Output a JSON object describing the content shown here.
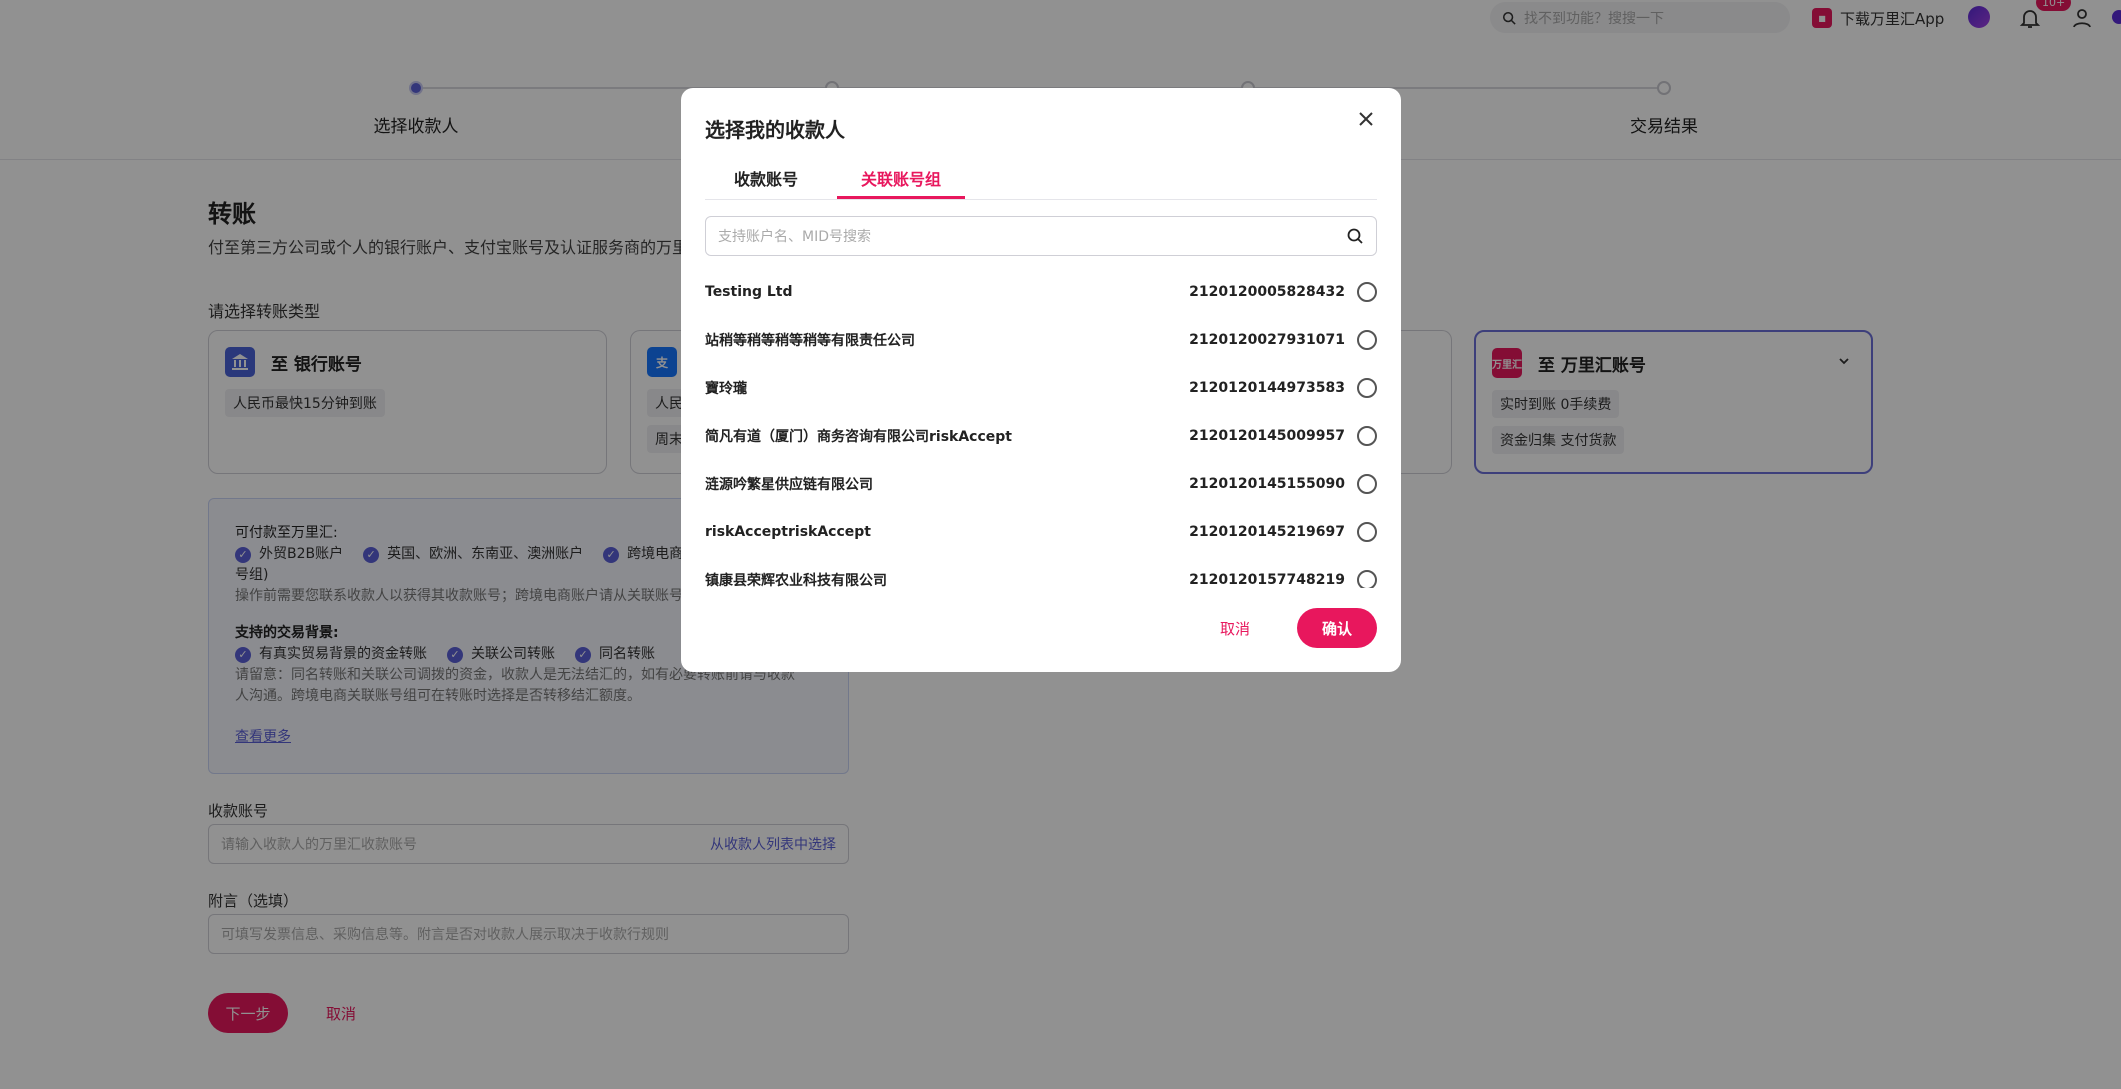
{
  "topbar": {
    "search_placeholder": "找不到功能？搜搜一下",
    "app_download": "下载万里汇App",
    "notification_count": "10+"
  },
  "stepper": {
    "steps": [
      "选择收款人",
      "",
      "",
      "交易结果"
    ]
  },
  "page": {
    "title": "转账",
    "description": "付至第三方公司或个人的银行账户、支付宝账号及认证服务商的万里",
    "type_section_label": "请选择转账类型"
  },
  "transfer_types": [
    {
      "title": "至 银行账号",
      "chips": [
        "人民币最快15分钟到账"
      ]
    },
    {
      "title": "",
      "chips": [
        "人民",
        "周末"
      ]
    },
    {
      "title": "至 万里汇账号",
      "chips": [
        "实时到账 0手续费",
        "资金归集 支付货款"
      ]
    }
  ],
  "info": {
    "payable_title": "可付款至万里汇:",
    "payable_items": [
      "外贸B2B账户",
      "英国、欧洲、东南亚、澳洲账户",
      "跨境电商"
    ],
    "payable_suffix": "号组)",
    "payable_note": "操作前需要您联系收款人以获得其收款账号；跨境电商账户请从关联账号组",
    "background_title": "支持的交易背景:",
    "background_items": [
      "有真实贸易背景的资金转账",
      "关联公司转账",
      "同名转账"
    ],
    "note_line1": "请留意：同名转账和关联公司调拨的资金，收款人是无法结汇的，如有必要转账前请与收款",
    "note_line2": "人沟通。跨境电商关联账号组可在转账时选择是否转移结汇额度。",
    "more_link": "查看更多"
  },
  "form": {
    "account_label": "收款账号",
    "account_placeholder": "请输入收款人的万里汇收款账号",
    "account_link": "从收款人列表中选择",
    "memo_label": "附言（选填）",
    "memo_placeholder": "可填写发票信息、采购信息等。附言是否对收款人展示取决于收款行规则",
    "next_button": "下一步",
    "cancel_button": "取消"
  },
  "modal": {
    "title": "选择我的收款人",
    "tabs": [
      "收款账号",
      "关联账号组"
    ],
    "search_placeholder": "支持账户名、MID号搜索",
    "rows": [
      {
        "name": "Testing Ltd",
        "id": "2120120005828432"
      },
      {
        "name": "站稍等稍等稍等稍等有限责任公司",
        "id": "2120120027931071"
      },
      {
        "name": "寶玲瓏",
        "id": "2120120144973583"
      },
      {
        "name": "简凡有道（厦门）商务咨询有限公司riskAccept",
        "id": "2120120145009957"
      },
      {
        "name": "涟源吟繁星供应链有限公司",
        "id": "2120120145155090"
      },
      {
        "name": "riskAcceptriskAccept",
        "id": "2120120145219697"
      },
      {
        "name": "镇康县荣辉农业科技有限公司",
        "id": "2120120157748219"
      }
    ],
    "cancel": "取消",
    "confirm": "确认"
  }
}
